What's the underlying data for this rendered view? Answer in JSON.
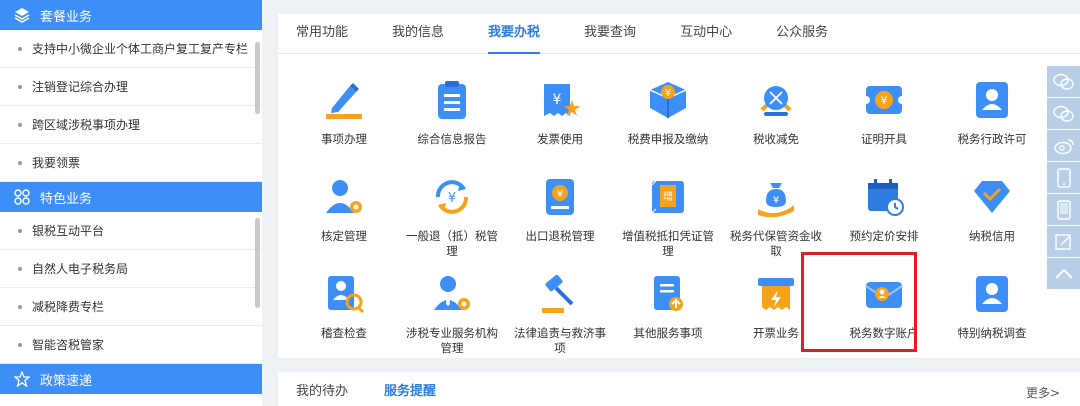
{
  "sidebar": {
    "sections": [
      {
        "title": "套餐业务",
        "icon": "layers-icon",
        "items": [
          "支持中小微企业个体工商户复工复产专栏",
          "注销登记综合办理",
          "跨区域涉税事项办理",
          "我要领票"
        ]
      },
      {
        "title": "特色业务",
        "icon": "grid-icon",
        "items": [
          "银税互动平台",
          "自然人电子税务局",
          "减税降费专栏",
          "智能咨税管家"
        ]
      },
      {
        "title": "政策速递",
        "icon": "star-icon",
        "items": []
      }
    ]
  },
  "tabs": [
    "常用功能",
    "我的信息",
    "我要办税",
    "我要查询",
    "互动中心",
    "公众服务"
  ],
  "active_tab": "我要办税",
  "functions": [
    [
      {
        "label": "事项办理",
        "icon": "pen-icon"
      },
      {
        "label": "综合信息报告",
        "icon": "clipboard-icon"
      },
      {
        "label": "发票使用",
        "icon": "invoice-star-icon"
      },
      {
        "label": "税费申报及缴纳",
        "icon": "tax-box-icon"
      },
      {
        "label": "税收减免",
        "icon": "reduction-icon"
      },
      {
        "label": "证明开具",
        "icon": "certificate-icon"
      },
      {
        "label": "税务行政许可",
        "icon": "license-user-icon"
      }
    ],
    [
      {
        "label": "核定管理",
        "icon": "user-gear-icon"
      },
      {
        "label": "一般退（抵）税管理",
        "icon": "refund-cycle-icon"
      },
      {
        "label": "出口退税管理",
        "icon": "export-refund-icon"
      },
      {
        "label": "增值税抵扣凭证管理",
        "icon": "vat-receipt-icon"
      },
      {
        "label": "税务代保管资金收取",
        "icon": "money-bag-icon"
      },
      {
        "label": "预约定价安排",
        "icon": "calendar-clock-icon"
      },
      {
        "label": "纳税信用",
        "icon": "diamond-check-icon"
      }
    ],
    [
      {
        "label": "稽查检查",
        "icon": "inspection-icon"
      },
      {
        "label": "涉税专业服务机构管理",
        "icon": "agency-user-icon"
      },
      {
        "label": "法律追责与救济事项",
        "icon": "gavel-icon"
      },
      {
        "label": "其他服务事项",
        "icon": "service-doc-icon"
      },
      {
        "label": "开票业务",
        "icon": "bolt-ticket-icon"
      },
      {
        "label": "税务数字账户",
        "icon": "digital-account-icon"
      },
      {
        "label": "特别纳税调查",
        "icon": "special-user-icon"
      }
    ]
  ],
  "bottom": {
    "tabs": [
      "我的待办",
      "服务提醒"
    ],
    "active": "服务提醒",
    "more": "更多>"
  },
  "float_toolbar": [
    "wechat-icon",
    "chat-icon",
    "weibo-icon",
    "phone-icon",
    "tablet-icon",
    "feedback-icon",
    "back-to-top-icon"
  ],
  "colors": {
    "accent": "#2f7de1",
    "sidebar_header": "#3e8ef7",
    "highlight": "#e02020"
  }
}
